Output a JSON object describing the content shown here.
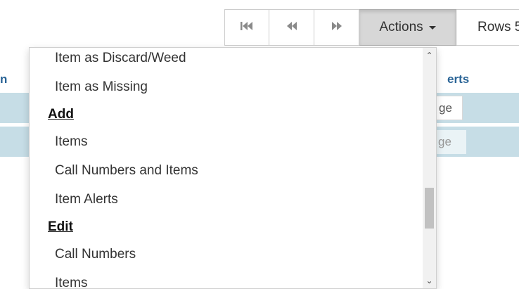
{
  "toolbar": {
    "first_icon": "first-page-icon",
    "prev_icon": "previous-page-icon",
    "next_icon": "next-page-icon",
    "actions_label": "Actions",
    "rows_label": "Rows 5"
  },
  "table": {
    "header_left_partial": "n",
    "header_right_partial": "erts",
    "row1_cell": "ge",
    "row2_cell": "ge"
  },
  "menu": {
    "items_before": [
      "Item as Discard/Weed",
      "Item as Missing"
    ],
    "add_header": "Add",
    "add_items": [
      "Items",
      "Call Numbers and Items",
      "Item Alerts"
    ],
    "edit_header": "Edit",
    "edit_items": [
      "Call Numbers",
      "Items"
    ]
  },
  "colors": {
    "row_band": "#c6dde6",
    "link_header": "#2a6496",
    "active_button": "#d7d7d7"
  }
}
